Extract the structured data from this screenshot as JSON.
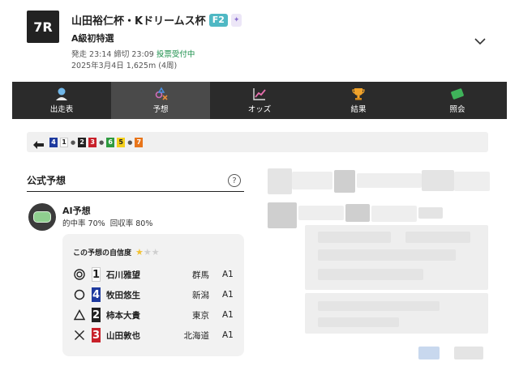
{
  "race": {
    "number": "7R",
    "title": "山田裕仁杯・Kドリームス杯",
    "grade": "F2",
    "class": "A級初特選",
    "times_prefix": "発走 23:14 締切 23:09",
    "status": "投票受付中",
    "date_info": "2025年3月4日 1,625m (4周)"
  },
  "tabs": [
    {
      "label": "出走表",
      "icon": "racer-icon"
    },
    {
      "label": "予想",
      "icon": "forecast-icon"
    },
    {
      "label": "オッズ",
      "icon": "chart-icon"
    },
    {
      "label": "結果",
      "icon": "trophy-icon"
    },
    {
      "label": "照会",
      "icon": "ticket-icon"
    }
  ],
  "active_tab": "予想",
  "result_strip": [
    {
      "num": "4",
      "bg": "#1e3a9e",
      "fg": "#ffffff"
    },
    {
      "num": "1",
      "bg": "#ffffff",
      "fg": "#222222"
    },
    {
      "num": "2",
      "bg": "#222222",
      "fg": "#ffffff"
    },
    {
      "num": "3",
      "bg": "#c8202a",
      "fg": "#ffffff"
    },
    {
      "num": "6",
      "bg": "#2e9b3f",
      "fg": "#ffffff"
    },
    {
      "num": "5",
      "bg": "#f3cf1c",
      "fg": "#222222"
    },
    {
      "num": "7",
      "bg": "#e8751a",
      "fg": "#ffffff"
    }
  ],
  "forecast": {
    "section_title": "公式予想",
    "help": "?",
    "ai_name": "AI予想",
    "hit_label": "的中率",
    "hit_rate": "70%",
    "return_label": "回収率",
    "return_rate": "80%",
    "confidence_label": "この予想の自信度",
    "confidence_stars": 1,
    "confidence_max": 3,
    "picks": [
      {
        "mark": "double-circle",
        "num": "1",
        "num_bg": "#ffffff",
        "num_fg": "#222222",
        "name": "石川雅望",
        "pref": "群馬",
        "cls": "A1"
      },
      {
        "mark": "circle",
        "num": "4",
        "num_bg": "#1e3a9e",
        "num_fg": "#ffffff",
        "name": "牧田悠生",
        "pref": "新潟",
        "cls": "A1"
      },
      {
        "mark": "triangle",
        "num": "2",
        "num_bg": "#222222",
        "num_fg": "#ffffff",
        "name": "柿本大貴",
        "pref": "東京",
        "cls": "A1"
      },
      {
        "mark": "cross",
        "num": "3",
        "num_bg": "#c8202a",
        "num_fg": "#ffffff",
        "name": "山田敦也",
        "pref": "北海道",
        "cls": "A1"
      }
    ]
  }
}
